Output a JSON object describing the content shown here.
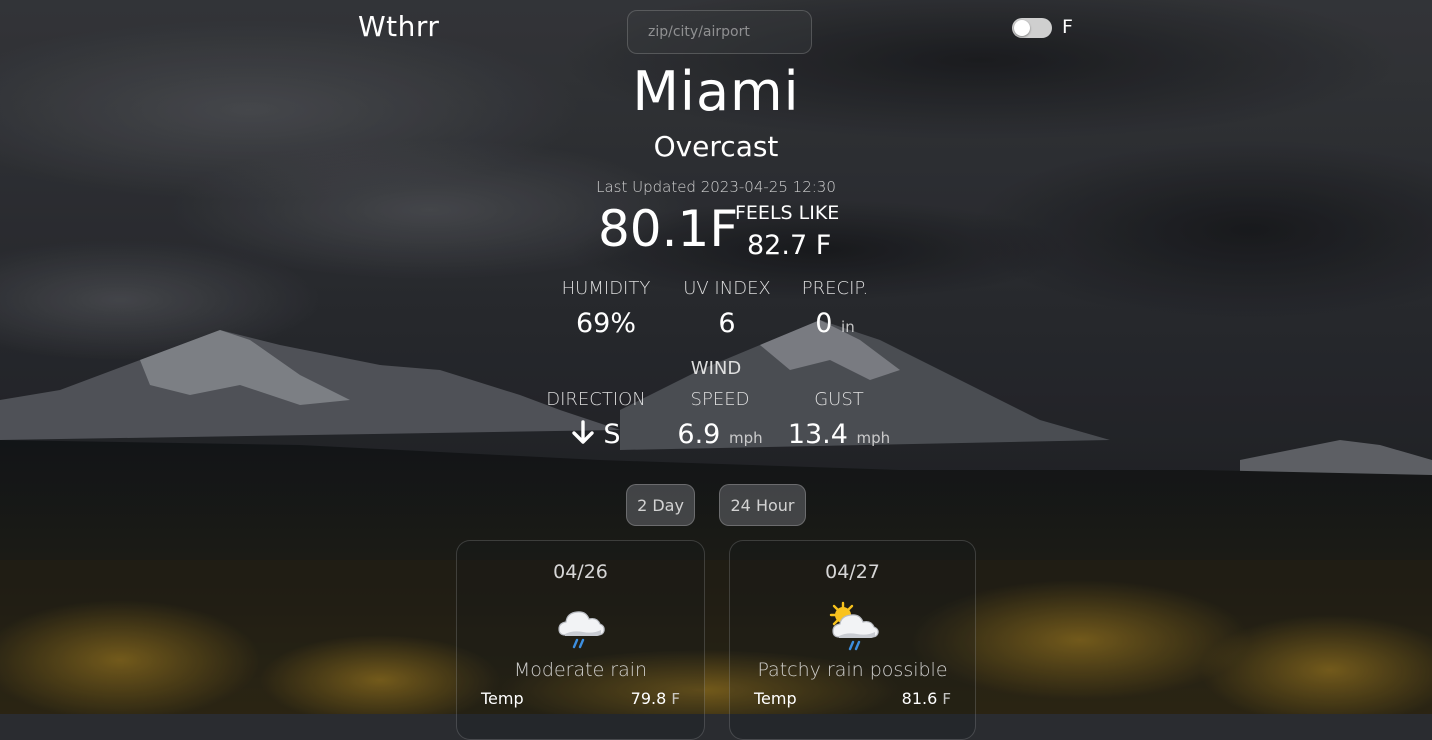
{
  "header": {
    "logo": "Wthrr",
    "search_placeholder": "zip/city/airport",
    "unit_toggle_label": "F"
  },
  "current": {
    "city": "Miami",
    "condition": "Overcast",
    "last_updated": "Last Updated 2023-04-25 12:30",
    "temperature": "80.1F",
    "feels_like_label": "FEELS LIKE",
    "feels_like_value": "82.7 F"
  },
  "stats": {
    "humidity_label": "HUMIDITY",
    "humidity_value": "69%",
    "uv_label": "UV INDEX",
    "uv_value": "6",
    "precip_label": "PRECIP.",
    "precip_value": "0",
    "precip_unit": "in"
  },
  "wind": {
    "title": "WIND",
    "direction_label": "DIRECTION",
    "direction_value": "S",
    "speed_label": "SPEED",
    "speed_value": "6.9",
    "speed_unit": "mph",
    "gust_label": "GUST",
    "gust_value": "13.4",
    "gust_unit": "mph"
  },
  "forecast_buttons": {
    "two_day": "2 Day",
    "hourly": "24 Hour"
  },
  "forecast": [
    {
      "date": "04/26",
      "icon": "rain-cloud-icon",
      "description": "Moderate rain",
      "temp_label": "Temp",
      "temp_value": "79.8",
      "temp_unit": "F"
    },
    {
      "date": "04/27",
      "icon": "sun-rain-cloud-icon",
      "description": "Patchy rain possible",
      "temp_label": "Temp",
      "temp_value": "81.6",
      "temp_unit": "F"
    }
  ]
}
